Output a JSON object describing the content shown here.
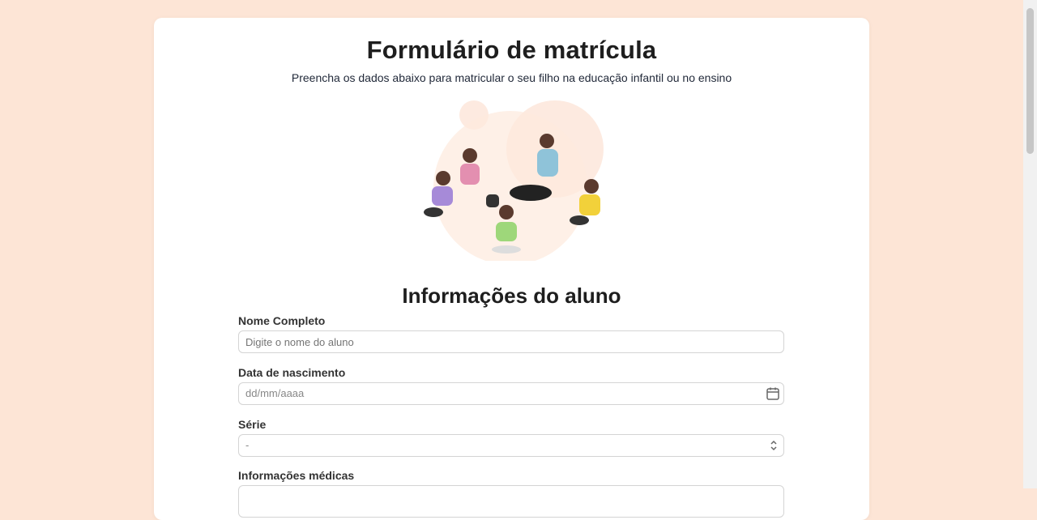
{
  "form": {
    "title": "Formulário de matrícula",
    "subtitle": "Preencha os dados abaixo para matricular o seu filho na educação infantil ou no ensino",
    "section_title": "Informações do aluno",
    "fields": [
      {
        "label": "Nome Completo",
        "type": "text",
        "placeholder": "Digite o nome do aluno"
      },
      {
        "label": "Data de nascimento",
        "type": "date",
        "placeholder": "dd/mm/aaaa"
      },
      {
        "label": "Série",
        "type": "select",
        "value": "-"
      },
      {
        "label": "Informações médicas",
        "type": "textarea",
        "placeholder": ""
      }
    ]
  },
  "illustration": {
    "icon": "children-with-teacher-illustration"
  },
  "colors": {
    "page_background": "#fde5d6",
    "card_background": "#ffffff",
    "title": "#1e1e1e"
  }
}
